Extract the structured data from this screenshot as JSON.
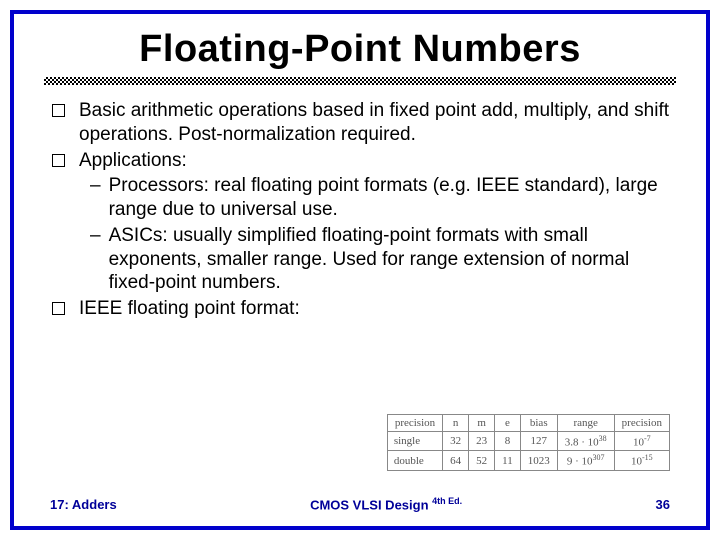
{
  "title": "Floating-Point Numbers",
  "bullets": {
    "b1": "Basic arithmetic operations based in fixed point add, multiply, and shift operations. Post-normalization required.",
    "b2": "Applications:",
    "s1": "Processors: real floating point formats (e.g. IEEE standard), large range due to universal use.",
    "s2": "ASICs: usually simplified floating-point formats with small exponents, smaller range. Used for range extension of normal fixed-point numbers.",
    "b3": "IEEE floating point format:"
  },
  "table": {
    "headers": [
      "precision",
      "n",
      "m",
      "e",
      "bias",
      "range",
      "precision"
    ],
    "rows": [
      {
        "label": "single",
        "n": "32",
        "m": "23",
        "e": "8",
        "bias": "127",
        "range_base": "3.8 · 10",
        "range_exp": "38",
        "prec_base": "10",
        "prec_exp": "-7"
      },
      {
        "label": "double",
        "n": "64",
        "m": "52",
        "e": "11",
        "bias": "1023",
        "range_base": "9 · 10",
        "range_exp": "307",
        "prec_base": "10",
        "prec_exp": "-15"
      }
    ]
  },
  "footer": {
    "left": "17: Adders",
    "center_main": "CMOS VLSI Design",
    "center_ed": "4th Ed.",
    "right": "36"
  }
}
